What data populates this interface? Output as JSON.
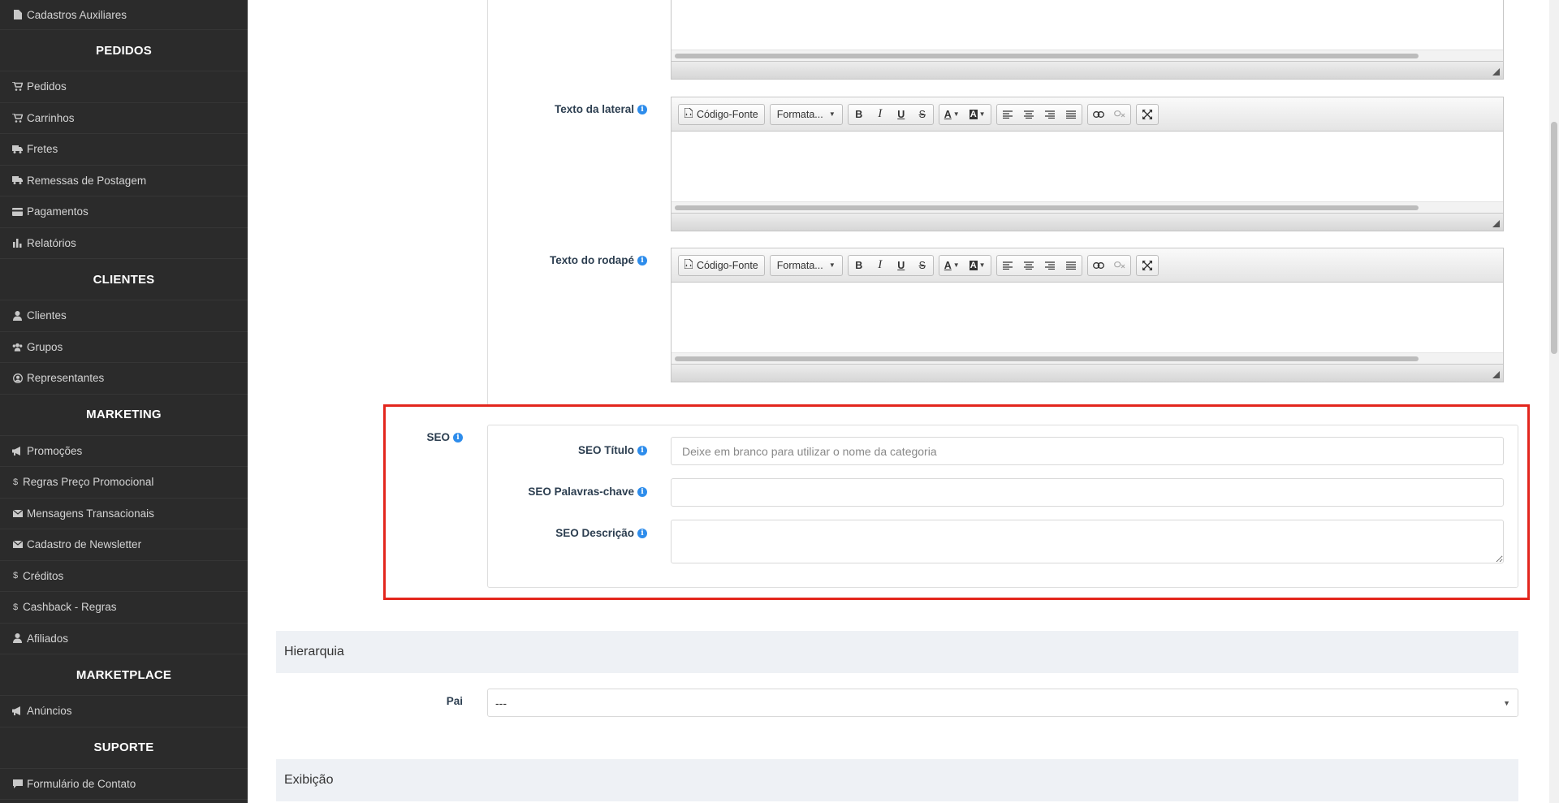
{
  "sidebar": {
    "top_item": {
      "label": "Cadastros Auxiliares",
      "icon": "file-icon"
    },
    "sections": [
      {
        "title": "PEDIDOS",
        "items": [
          {
            "label": "Pedidos",
            "icon": "cart-icon"
          },
          {
            "label": "Carrinhos",
            "icon": "cart-icon"
          },
          {
            "label": "Fretes",
            "icon": "truck-icon"
          },
          {
            "label": "Remessas de Postagem",
            "icon": "truck-icon"
          },
          {
            "label": "Pagamentos",
            "icon": "credit-card-icon"
          },
          {
            "label": "Relatórios",
            "icon": "bar-chart-icon"
          }
        ]
      },
      {
        "title": "CLIENTES",
        "items": [
          {
            "label": "Clientes",
            "icon": "user-icon"
          },
          {
            "label": "Grupos",
            "icon": "users-icon"
          },
          {
            "label": "Representantes",
            "icon": "user-circle-icon"
          }
        ]
      },
      {
        "title": "MARKETING",
        "items": [
          {
            "label": "Promoções",
            "icon": "bullhorn-icon"
          },
          {
            "label": "Regras Preço Promocional",
            "icon": "dollar-icon"
          },
          {
            "label": "Mensagens Transacionais",
            "icon": "envelope-icon"
          },
          {
            "label": "Cadastro de Newsletter",
            "icon": "envelope-icon"
          },
          {
            "label": "Créditos",
            "icon": "dollar-icon"
          },
          {
            "label": "Cashback - Regras",
            "icon": "dollar-icon"
          },
          {
            "label": "Afiliados",
            "icon": "user-icon"
          }
        ]
      },
      {
        "title": "MARKETPLACE",
        "items": [
          {
            "label": "Anúncios",
            "icon": "bullhorn-icon"
          }
        ]
      },
      {
        "title": "SUPORTE",
        "items": [
          {
            "label": "Formulário de Contato",
            "icon": "comment-icon"
          }
        ]
      }
    ]
  },
  "editors": [
    {
      "label": "Texto da lateral"
    },
    {
      "label": "Texto do rodapé"
    }
  ],
  "editor_toolbar": {
    "source_label": "Código-Fonte",
    "format_label": "Formata...",
    "bold": "B",
    "italic": "I",
    "underline": "U",
    "strike": "S",
    "text_color": "A",
    "bg_color": "A"
  },
  "seo": {
    "label": "SEO",
    "title_label": "SEO Título",
    "title_placeholder": "Deixe em branco para utilizar o nome da categoria",
    "keywords_label": "SEO Palavras-chave",
    "description_label": "SEO Descrição"
  },
  "hierarchy": {
    "section_title": "Hierarquia",
    "parent_label": "Pai",
    "parent_value": "---"
  },
  "display": {
    "section_title": "Exibição"
  },
  "colors": {
    "sidebar_bg": "#2b2b2b",
    "highlight": "#e3261d",
    "info_icon": "#2d8ceb",
    "section_bg": "#eef1f5"
  }
}
